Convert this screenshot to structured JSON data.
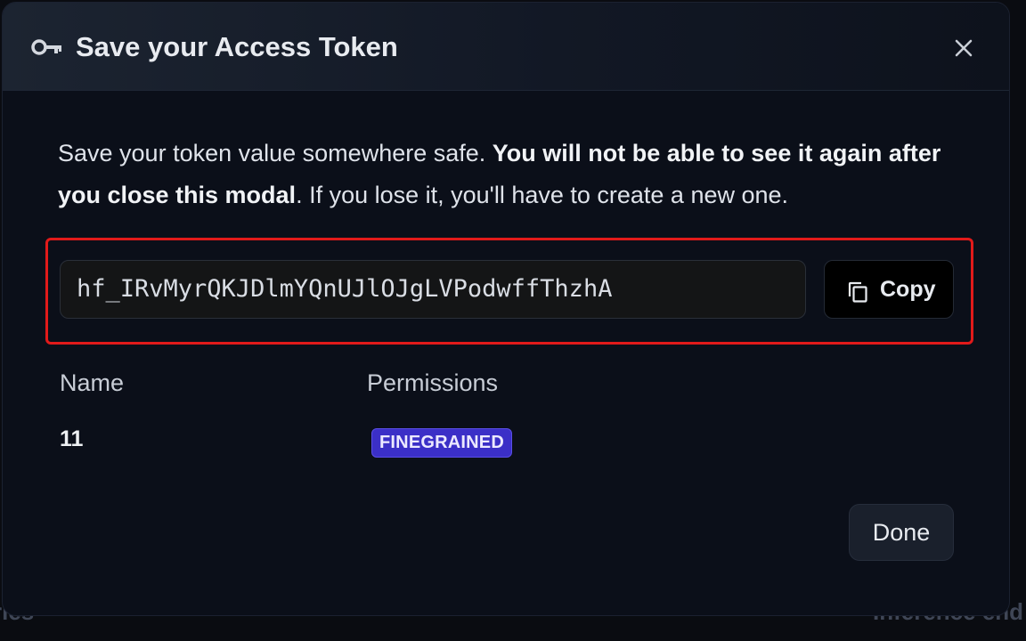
{
  "background": {
    "left_text": "ries",
    "right_text": "Inference end"
  },
  "modal": {
    "title": "Save your Access Token",
    "title_icon": "key-icon",
    "close_icon": "close-icon",
    "description": {
      "part1": "Save your token value somewhere safe. ",
      "bold": "You will not be able to see it again after you close this modal",
      "part2": ". If you lose it, you'll have to create a new one."
    },
    "token": {
      "value": "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",
      "highlight_color": "#e21a1a"
    },
    "copy_button": {
      "label": "Copy",
      "icon": "copy-icon"
    },
    "table": {
      "name_header": "Name",
      "permissions_header": "Permissions",
      "name_value": "11",
      "permission_badge": "FINEGRAINED",
      "badge_color": "#3b2fc7"
    },
    "done_button": {
      "label": "Done"
    }
  }
}
